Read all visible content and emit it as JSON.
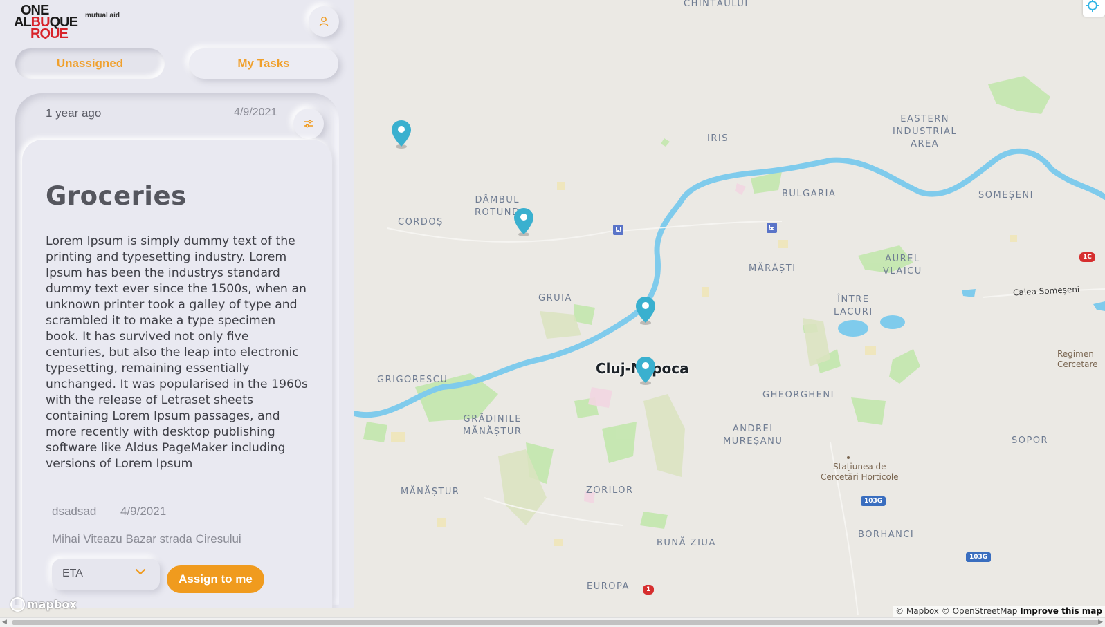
{
  "app": {
    "logo_text": "ONE ALBUQUE RQUE",
    "tagline": "mutual aid"
  },
  "tabs": [
    {
      "label": "Unassigned",
      "active": true
    },
    {
      "label": "My Tasks",
      "active": false
    }
  ],
  "task": {
    "relative_time": "1 year ago",
    "date": "4/9/2021",
    "title": "Groceries",
    "description": "Lorem Ipsum is simply dummy text of the printing and typesetting industry. Lorem Ipsum has been the industrys standard dummy text ever since the 1500s, when an unknown printer took a galley of type and scrambled it to make a type specimen book. It has survived not only five centuries, but also the leap into electronic typesetting, remaining essentially unchanged. It was popularised in the 1960s with the release of Letraset sheets containing Lorem Ipsum passages, and more recently with desktop publishing software like Aldus PageMaker including versions of Lorem Ipsum",
    "requester": "dsadsad",
    "requested_date": "4/9/2021",
    "address": "Mihai Viteazu Bazar strada Ciresului",
    "eta_select": {
      "selected": "ETA"
    },
    "assign_label": "Assign to me"
  },
  "map": {
    "city": "Cluj-Napoca",
    "labels": {
      "chintaului": "CHINTĂULUI",
      "eastern": "EASTERN\nINDUSTRIAL\nAREA",
      "iris": "IRIS",
      "dambul": "DÂMBUL\nROTUND",
      "cordos": "CORDOȘ",
      "bulgaria": "BULGARIA",
      "someseni": "SOMEȘENI",
      "marasti": "MĂRĂȘTI",
      "aurel": "AUREL\nVLAICU",
      "gruia": "GRUIA",
      "intre_lacuri": "ÎNTRE\nLACURI",
      "grigorescu": "GRIGORESCU",
      "gheorgheni": "GHEORGHENI",
      "gradinile": "GRĂDINILE\nMĂNĂȘTUR",
      "andrei": "ANDREI\nMUREȘANU",
      "sopor": "SOPOR",
      "manastur": "MĂNĂȘTUR",
      "zorilor": "ZORILOR",
      "borhanci": "BORHANCI",
      "buna_ziua": "BUNĂ ZIUA",
      "europa": "EUROPA"
    },
    "pois": {
      "statiunea": "Stațiunea de\nCercetări Horticole",
      "regimen": "Regimen\nCercetare"
    },
    "road_label": "Calea Someșeni",
    "shields": {
      "s1c": "1C",
      "s103g_a": "103G",
      "s103g_b": "103G",
      "s1": "1"
    },
    "markers_count": 4,
    "attribution": {
      "mapbox": "© Mapbox",
      "osm": "© OpenStreetMap",
      "improve": "Improve this map"
    },
    "logo": "mapbox",
    "colors": {
      "water": "#7fcbec",
      "park": "#bfe6a8",
      "marker": "#3ab0cf",
      "accent": "#f09b1e"
    }
  },
  "icons": {
    "user": "user-icon",
    "filter": "sliders-icon",
    "chevron": "chevron-down-icon",
    "marker": "map-pin-icon",
    "transit": "train-icon",
    "geolocate": "geolocate-icon"
  }
}
